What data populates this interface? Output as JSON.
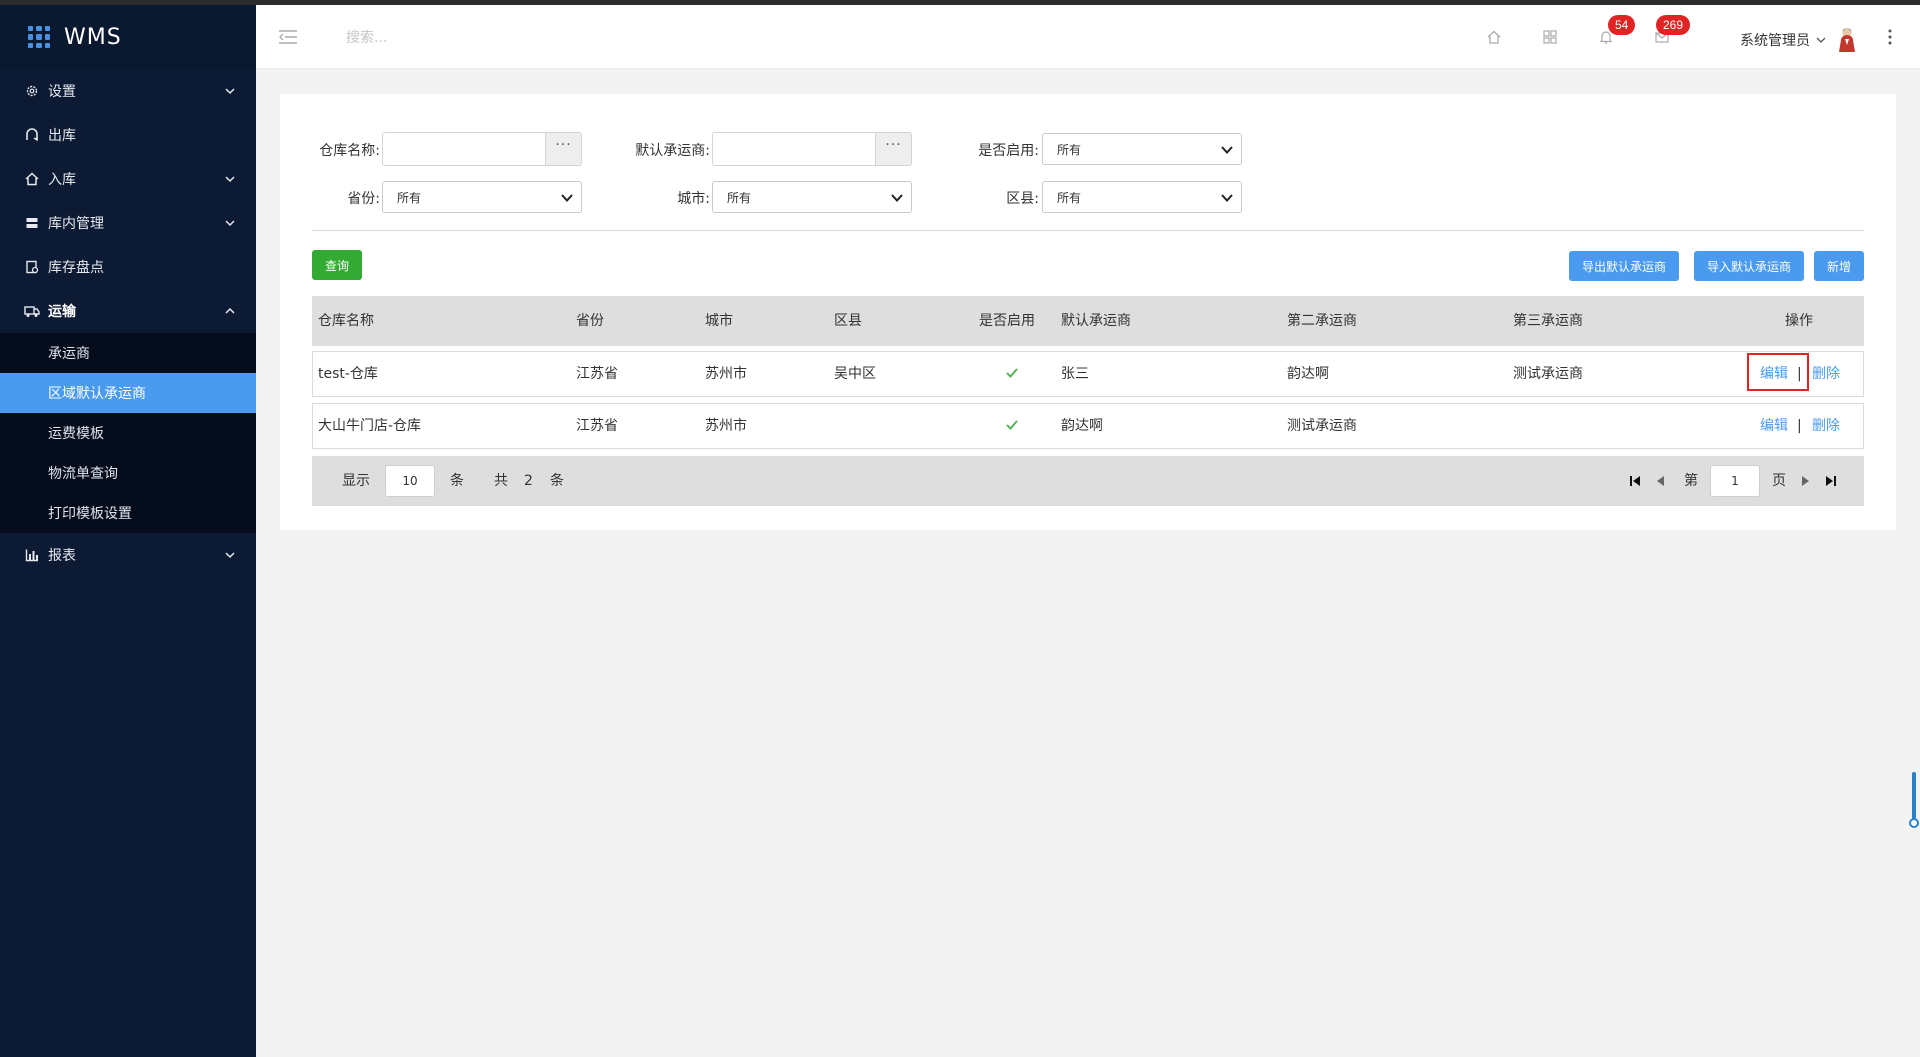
{
  "app": {
    "title": "WMS"
  },
  "sidebar": {
    "items": [
      {
        "label": "设置",
        "icon": "gear-icon",
        "chevron": "down"
      },
      {
        "label": "出库",
        "icon": "outbound-icon",
        "chevron": ""
      },
      {
        "label": "入库",
        "icon": "inbound-icon",
        "chevron": "down"
      },
      {
        "label": "库内管理",
        "icon": "warehouse-icon",
        "chevron": "down"
      },
      {
        "label": "库存盘点",
        "icon": "inventory-icon",
        "chevron": ""
      },
      {
        "label": "运输",
        "icon": "truck-icon",
        "chevron": "up"
      },
      {
        "label": "报表",
        "icon": "bar-chart-icon",
        "chevron": "down"
      }
    ],
    "transport_sub": [
      {
        "label": "承运商"
      },
      {
        "label": "区域默认承运商",
        "active": true
      },
      {
        "label": "运费模板"
      },
      {
        "label": "物流单查询"
      },
      {
        "label": "打印模板设置"
      }
    ]
  },
  "header": {
    "search_placeholder": "搜索...",
    "notifications_count": "54",
    "messages_count": "269",
    "user_name": "系统管理员"
  },
  "filters": {
    "warehouse_name_label": "仓库名称:",
    "default_carrier_label": "默认承运商:",
    "enabled_label": "是否启用:",
    "enabled_value": "所有",
    "province_label": "省份:",
    "province_value": "所有",
    "city_label": "城市:",
    "city_value": "所有",
    "district_label": "区县:",
    "district_value": "所有",
    "picker_dots": "···"
  },
  "actions": {
    "query": "查询",
    "export": "导出默认承运商",
    "import": "导入默认承运商",
    "add": "新增"
  },
  "table": {
    "headers": [
      "仓库名称",
      "省份",
      "城市",
      "区县",
      "是否启用",
      "默认承运商",
      "第二承运商",
      "第三承运商",
      "操作"
    ],
    "rows": [
      {
        "warehouse": "test-仓库",
        "province": "江苏省",
        "city": "苏州市",
        "district": "吴中区",
        "enabled": true,
        "carrier1": "张三",
        "carrier2": "韵达啊",
        "carrier3": "测试承运商",
        "edit": "编辑",
        "sep": "|",
        "delete": "删除"
      },
      {
        "warehouse": "大山牛门店-仓库",
        "province": "江苏省",
        "city": "苏州市",
        "district": "",
        "enabled": true,
        "carrier1": "韵达啊",
        "carrier2": "测试承运商",
        "carrier3": "",
        "edit": "编辑",
        "sep": "|",
        "delete": "删除"
      }
    ]
  },
  "pager": {
    "show_label": "显示",
    "page_size": "10",
    "unit": "条",
    "total_prefix": "共",
    "total": "2",
    "total_unit": "条",
    "page_prefix": "第",
    "page": "1",
    "page_suffix": "页"
  },
  "colors": {
    "sidebar_bg": "#0c1a33",
    "active_item": "#4a9af0",
    "primary_button": "#4a9af0",
    "query_button": "#33aa33",
    "badge": "#e02424",
    "highlight_box": "#e02424"
  }
}
